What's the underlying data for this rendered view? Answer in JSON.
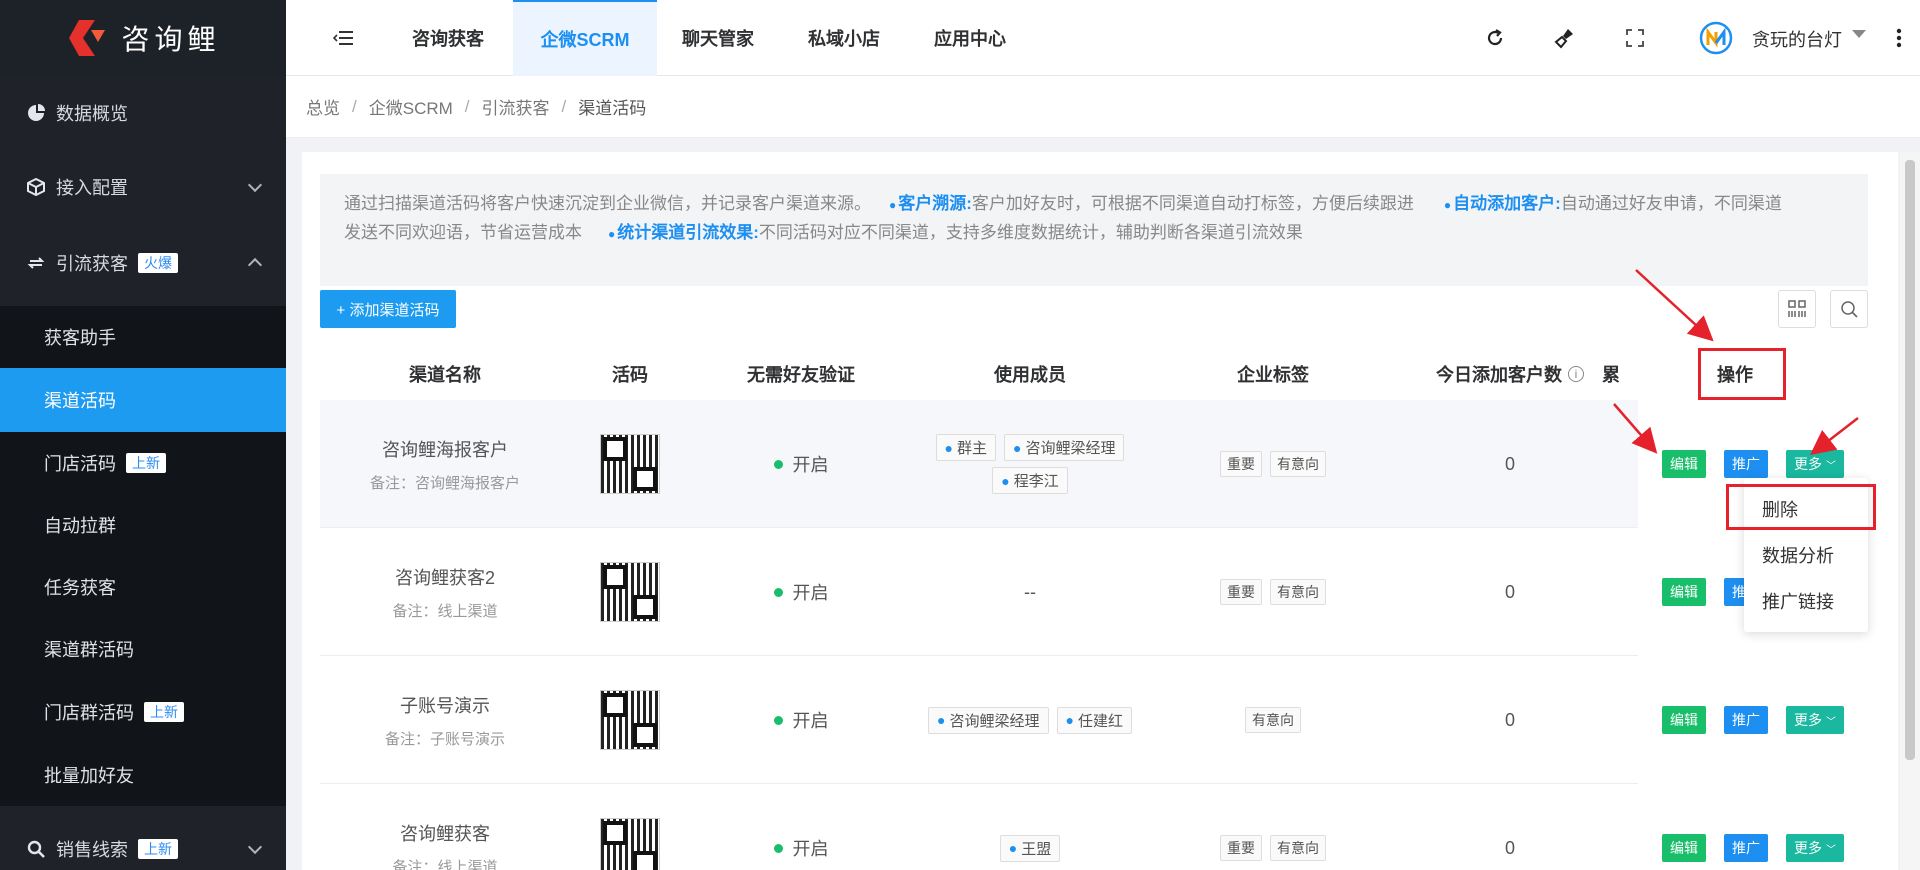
{
  "logo": {
    "text": "咨询鲤"
  },
  "sidebar": {
    "items": [
      {
        "label": "数据概览",
        "icon": "pie-chart-icon"
      },
      {
        "label": "接入配置",
        "icon": "cube-icon"
      },
      {
        "label": "引流获客",
        "icon": "refresh-arrows-icon",
        "badge": "火爆"
      },
      {
        "label": "销售线索",
        "icon": "search-icon",
        "badge": "上新"
      }
    ],
    "sub_items": [
      {
        "label": "获客助手"
      },
      {
        "label": "渠道活码"
      },
      {
        "label": "门店活码",
        "badge": "上新"
      },
      {
        "label": "自动拉群"
      },
      {
        "label": "任务获客"
      },
      {
        "label": "渠道群活码"
      },
      {
        "label": "门店群活码",
        "badge": "上新"
      },
      {
        "label": "批量加好友"
      }
    ]
  },
  "topbar": {
    "tabs": [
      "咨询获客",
      "企微SCRM",
      "聊天管家",
      "私域小店",
      "应用中心"
    ],
    "user": "贪玩的台灯"
  },
  "breadcrumb": [
    "总览",
    "企微SCRM",
    "引流获客",
    "渠道活码"
  ],
  "notice": {
    "intro": "通过扫描渠道活码将客户快速沉淀到企业微信，并记录客户渠道来源。",
    "p1_title": "客户溯源:",
    "p1_text": "客户加好友时，可根据不同渠道自动打标签，方便后续跟进",
    "p2_title": "自动添加客户:",
    "p2_text": "自动通过好友申请，不同渠道",
    "p2_text2": "发送不同欢迎语，节省运营成本",
    "p3_title": "统计渠道引流效果:",
    "p3_text": "不同活码对应不同渠道，支持多维度数据统计，辅助判断各渠道引流效果"
  },
  "toolbar": {
    "add_label": "+ 添加渠道活码"
  },
  "table": {
    "headers": [
      "渠道名称",
      "活码",
      "无需好友验证",
      "使用成员",
      "企业标签",
      "今日添加客户数",
      "累",
      "操作"
    ],
    "rows": [
      {
        "name": "咨询鲤海报客户",
        "note": "备注：咨询鲤海报客户",
        "status": "开启",
        "members": [
          "群主",
          "咨询鲤梁经理",
          "程李江"
        ],
        "tags": [
          "重要",
          "有意向"
        ],
        "today": "0"
      },
      {
        "name": "咨询鲤获客2",
        "note": "备注：线上渠道",
        "status": "开启",
        "members_text": "--",
        "tags": [
          "重要",
          "有意向"
        ],
        "today": "0"
      },
      {
        "name": "子账号演示",
        "note": "备注：子账号演示",
        "status": "开启",
        "members": [
          "咨询鲤梁经理",
          "任建红"
        ],
        "tags": [
          "有意向"
        ],
        "today": "0"
      },
      {
        "name": "咨询鲤获客",
        "note": "备注：线上渠道",
        "status": "开启",
        "members": [
          "王盟"
        ],
        "tags": [
          "重要",
          "有意向"
        ],
        "today": "0"
      }
    ],
    "actions": {
      "edit": "编辑",
      "promote": "推广",
      "more": "更多"
    }
  },
  "dropdown": [
    "删除",
    "数据分析",
    "推广链接"
  ],
  "colors": {
    "accent": "#1d9bf0",
    "sidebar_bg": "#1f2329",
    "edit_green": "#19be6b",
    "annotation_red": "#e5212b"
  }
}
